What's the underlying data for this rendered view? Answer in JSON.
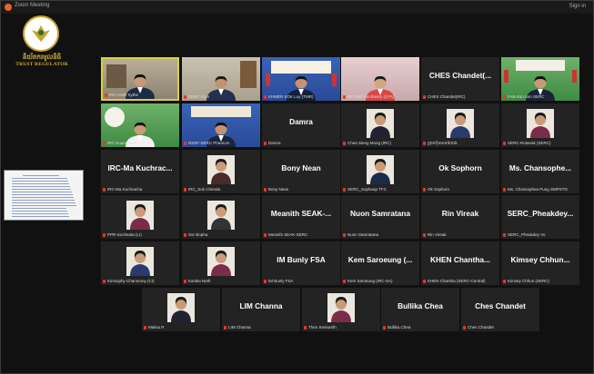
{
  "window": {
    "title": "Zoom Meeting",
    "sign_in": "Sign in"
  },
  "logo": {
    "khmer": "និយ័តករមូលនិធិ",
    "english": "TRUST REGULATOR"
  },
  "participants": [
    {
      "name": "",
      "label": "IRC-HOR Sythe",
      "scene": "office"
    },
    {
      "name": "",
      "label": "SERC-Sam",
      "scene": "room"
    },
    {
      "name": "",
      "label": "KHMER SOK Luy (TMR)",
      "scene": "blue"
    },
    {
      "name": "",
      "label": "SE-NBF Kuntheary (CFA)",
      "scene": "pink"
    },
    {
      "name": "CHES  Chandet(...",
      "label": "CHES Chandet(IRC)",
      "scene": "none"
    },
    {
      "name": "",
      "label": "FAB-Kim Sim SERC",
      "scene": "green"
    },
    {
      "name": "",
      "label": "IRC-Supervision",
      "scene": "green2"
    },
    {
      "name": "",
      "label": "NSSF-SERC Phearum",
      "scene": "blue2"
    },
    {
      "name": "Damra",
      "label": "Damra",
      "scene": "none"
    },
    {
      "name": "",
      "label": "Chea Sieng Mong (IRC)",
      "scene": "smallpic"
    },
    {
      "name": "",
      "label": "ក្រុមហ៊ុនធានារ៉ាប់រង",
      "scene": "smallpic"
    },
    {
      "name": "",
      "label": "SERC-Rotanak (SERC)",
      "scene": "smallpic"
    },
    {
      "name": "IRC-Ma  Kuchrac...",
      "label": "IRC-Ma Kuchracha",
      "scene": "none"
    },
    {
      "name": "",
      "label": "IRC_Sok Chenda",
      "scene": "smallpic"
    },
    {
      "name": "Bony  Nean",
      "label": "Bony Nean",
      "scene": "none"
    },
    {
      "name": "",
      "label": "SERC_Sopheap TFC",
      "scene": "smallpic"
    },
    {
      "name": "Ok  Sophorn",
      "label": "Ok Sophorn",
      "scene": "none"
    },
    {
      "name": "Ms.  Chansophe...",
      "label": "Ms. Chansophea Pung SMPSTG",
      "scene": "none"
    },
    {
      "name": "",
      "label": "PPR-Socheata (LI)",
      "scene": "smallpic"
    },
    {
      "name": "",
      "label": "Sor Bopha",
      "scene": "smallpic"
    },
    {
      "name": "Meanith  SEAK-...",
      "label": "Meanith SEAK-SERC",
      "scene": "none"
    },
    {
      "name": "Nuon  Samratana",
      "label": "Nuon Samratana",
      "scene": "none"
    },
    {
      "name": "Rin  Vireak",
      "label": "Rin Vireak",
      "scene": "none"
    },
    {
      "name": "SERC_Pheakdey...",
      "label": "SERC_Pheakdey Vo",
      "scene": "none"
    },
    {
      "name": "",
      "label": "Kimsophy Chanmony (CI)",
      "scene": "smallpic"
    },
    {
      "name": "",
      "label": "Kanika Neth",
      "scene": "smallpic"
    },
    {
      "name": "IM  Bunly  FSA",
      "label": "IM Bunly FSA",
      "scene": "none"
    },
    {
      "name": "Kem  Saroeung  (...",
      "label": "Kem Saroeung (IRC-SA)",
      "scene": "none"
    },
    {
      "name": "KHEN  Chantha...",
      "label": "KHEN Chantha (SERC-Central)",
      "scene": "none"
    },
    {
      "name": "Kimsey  Chhun...",
      "label": "Kimsey Chhun (SERC)",
      "scene": "none"
    },
    {
      "name": "",
      "label": "Malisa R",
      "scene": "smallpic"
    },
    {
      "name": "LIM  Channa",
      "label": "LIM Channa",
      "scene": "none"
    },
    {
      "name": "",
      "label": "Then Sreinarith",
      "scene": "smallpic"
    },
    {
      "name": "Bullika  Chea",
      "label": "Bullika Chea",
      "scene": "none"
    },
    {
      "name": "Ches  Chandet",
      "label": "Ches Chandet",
      "scene": "none"
    }
  ]
}
